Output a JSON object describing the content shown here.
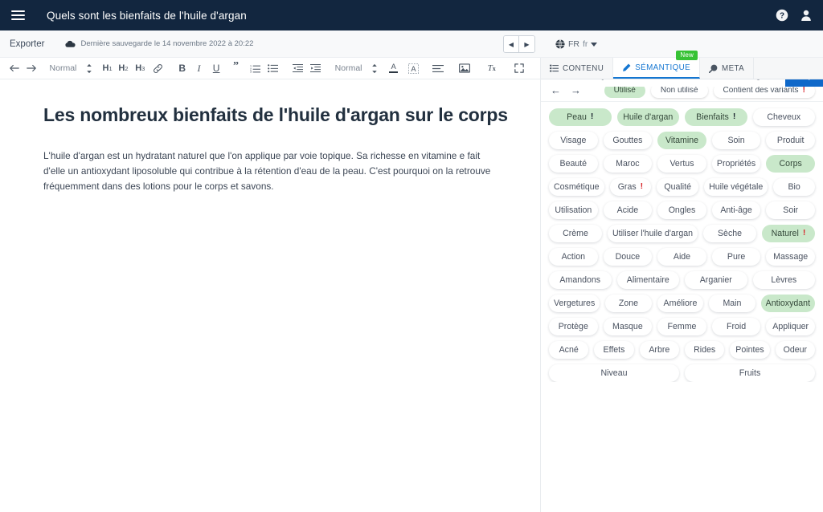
{
  "navbar": {
    "title": "Quels sont les bienfaits de l'huile d'argan",
    "menu_icon": "hamburger-icon",
    "help_icon": "help-circle-icon",
    "user_icon": "user-account-icon"
  },
  "subbar": {
    "export_label": "Exporter",
    "save_status": "Dernière sauvegarde le 14 novembre 2022 à 20:22",
    "cloud_icon": "cloud-icon",
    "prev_label": "◀",
    "next_label": "▶",
    "language_code": "FR",
    "language_sub": "fr",
    "globe_icon": "globe-icon",
    "search_value": "Quels sont les bienfaits de l'huile d'argan",
    "search_placeholder": "Quels sont les bienfaits de l'huile d'argan",
    "search_icon": "magnifier-icon"
  },
  "toolbar": {
    "undo_label": "←",
    "redo_label": "→",
    "style_label": "Normal",
    "h1_label": "H1",
    "h2_label": "H2",
    "h3_label": "H3",
    "link_icon": "link-icon",
    "bold_label": "B",
    "italic_label": "I",
    "underline_label": "U",
    "quote_label": "”",
    "ordered_list_icon": "ordered-list-icon",
    "bullet_list_icon": "bullet-list-icon",
    "outdent_icon": "outdent-icon",
    "indent_icon": "indent-icon",
    "font_label": "Normal",
    "text_color_label": "A",
    "highlight_label": "A",
    "align_icon": "align-icon",
    "image_icon": "image-icon",
    "clear_format_label": "Tx",
    "fullscreen_icon": "expand-icon"
  },
  "document": {
    "heading": "Les nombreux bienfaits de l'huile d'argan sur le corps",
    "paragraph": "L'huile d'argan est un hydratant naturel que l'on applique par voie topique. Sa richesse en vitamine e fait d'elle un antioxydant liposoluble qui contribue à la rétention d'eau de la peau. C'est pourquoi on la retrouve fréquemment dans des lotions pour le corps et savons."
  },
  "side_panel": {
    "tabs": [
      {
        "label": "CONTENU",
        "icon": "list-icon",
        "active": false,
        "badge": null
      },
      {
        "label": "SÉMANTIQUE",
        "icon": "pencil-icon",
        "active": true,
        "badge": "New"
      },
      {
        "label": "META",
        "icon": "comet-icon",
        "active": false,
        "badge": null
      }
    ],
    "filters": {
      "back_label": "←",
      "forward_label": "→",
      "pills": [
        {
          "label": "Utilisé",
          "active": true,
          "bang": false
        },
        {
          "label": "Non utilisé",
          "active": false,
          "bang": false
        },
        {
          "label": "Contient des variants",
          "active": false,
          "bang": true
        }
      ]
    },
    "accent_green": "#c9e8ca",
    "accent_blue": "#1476d1",
    "bang_red": "#d8272c",
    "tag_rows": [
      [
        {
          "label": "Peau",
          "active": true,
          "bang": "dark"
        },
        {
          "label": "Huile d'argan",
          "active": true,
          "bang": null
        },
        {
          "label": "Bienfaits",
          "active": true,
          "bang": "dark"
        },
        {
          "label": "Cheveux",
          "active": false,
          "bang": null
        }
      ],
      [
        {
          "label": "Visage",
          "active": false,
          "bang": null
        },
        {
          "label": "Gouttes",
          "active": false,
          "bang": null
        },
        {
          "label": "Vitamine",
          "active": true,
          "bang": null
        },
        {
          "label": "Soin",
          "active": false,
          "bang": null
        },
        {
          "label": "Produit",
          "active": false,
          "bang": null
        }
      ],
      [
        {
          "label": "Beauté",
          "active": false,
          "bang": null
        },
        {
          "label": "Maroc",
          "active": false,
          "bang": null
        },
        {
          "label": "Vertus",
          "active": false,
          "bang": null
        },
        {
          "label": "Propriétés",
          "active": false,
          "bang": null
        },
        {
          "label": "Corps",
          "active": true,
          "bang": null
        }
      ],
      [
        {
          "label": "Cosmétique",
          "active": false,
          "bang": null
        },
        {
          "label": "Gras",
          "active": false,
          "bang": "red"
        },
        {
          "label": "Qualité",
          "active": false,
          "bang": null
        },
        {
          "label": "Huile végétale",
          "active": false,
          "bang": null
        },
        {
          "label": "Bio",
          "active": false,
          "bang": null
        }
      ],
      [
        {
          "label": "Utilisation",
          "active": false,
          "bang": null
        },
        {
          "label": "Acide",
          "active": false,
          "bang": null
        },
        {
          "label": "Ongles",
          "active": false,
          "bang": null
        },
        {
          "label": "Anti-âge",
          "active": false,
          "bang": null
        },
        {
          "label": "Soir",
          "active": false,
          "bang": null
        }
      ],
      [
        {
          "label": "Crème",
          "active": false,
          "bang": null
        },
        {
          "label": "Utiliser l'huile d'argan",
          "active": false,
          "bang": null
        },
        {
          "label": "Sèche",
          "active": false,
          "bang": null
        },
        {
          "label": "Naturel",
          "active": true,
          "bang": "red"
        }
      ],
      [
        {
          "label": "Action",
          "active": false,
          "bang": null
        },
        {
          "label": "Douce",
          "active": false,
          "bang": null
        },
        {
          "label": "Aide",
          "active": false,
          "bang": null
        },
        {
          "label": "Pure",
          "active": false,
          "bang": null
        },
        {
          "label": "Massage",
          "active": false,
          "bang": null
        }
      ],
      [
        {
          "label": "Amandons",
          "active": false,
          "bang": null
        },
        {
          "label": "Alimentaire",
          "active": false,
          "bang": null
        },
        {
          "label": "Arganier",
          "active": false,
          "bang": null
        },
        {
          "label": "Lèvres",
          "active": false,
          "bang": null
        }
      ],
      [
        {
          "label": "Vergetures",
          "active": false,
          "bang": null
        },
        {
          "label": "Zone",
          "active": false,
          "bang": null
        },
        {
          "label": "Améliore",
          "active": false,
          "bang": null
        },
        {
          "label": "Main",
          "active": false,
          "bang": null
        },
        {
          "label": "Antioxydant",
          "active": true,
          "bang": null
        }
      ],
      [
        {
          "label": "Protège",
          "active": false,
          "bang": null
        },
        {
          "label": "Masque",
          "active": false,
          "bang": null
        },
        {
          "label": "Femme",
          "active": false,
          "bang": null
        },
        {
          "label": "Froid",
          "active": false,
          "bang": null
        },
        {
          "label": "Appliquer",
          "active": false,
          "bang": null
        }
      ],
      [
        {
          "label": "Acné",
          "active": false,
          "bang": null
        },
        {
          "label": "Effets",
          "active": false,
          "bang": null
        },
        {
          "label": "Arbre",
          "active": false,
          "bang": null
        },
        {
          "label": "Rides",
          "active": false,
          "bang": null
        },
        {
          "label": "Pointes",
          "active": false,
          "bang": null
        },
        {
          "label": "Odeur",
          "active": false,
          "bang": null
        }
      ],
      [
        {
          "label": "Niveau",
          "active": false,
          "bang": null
        },
        {
          "label": "Fruits",
          "active": false,
          "bang": null
        }
      ]
    ]
  }
}
